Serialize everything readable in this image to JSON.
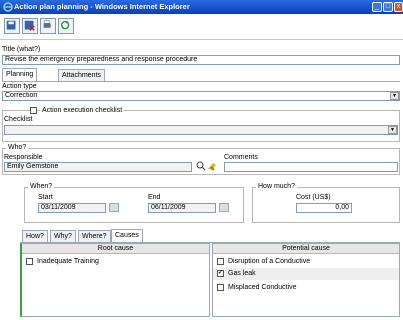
{
  "window": {
    "title": "Action plan planning - Windows Internet Explorer"
  },
  "title_section": {
    "label": "Title (what?)",
    "value": "Revise the emergency preparedness and response procedure"
  },
  "main_tabs": [
    {
      "label": "Planning"
    },
    {
      "label": "Attachments"
    }
  ],
  "action_type": {
    "label": "Action type",
    "value": "Correction"
  },
  "execution_checklist": {
    "checkbox_label": "Action execution checklist",
    "checklist_label": "Checklist",
    "value": ""
  },
  "who": {
    "group_label": "Who?",
    "responsible_label": "Responsible",
    "responsible_value": "Emily Gemstone",
    "comments_label": "Comments",
    "comments_value": ""
  },
  "when": {
    "group_label": "When?",
    "start_label": "Start",
    "start_value": "03/11/2009",
    "end_label": "End",
    "end_value": "06/11/2009"
  },
  "how_much": {
    "group_label": "How much?",
    "cost_label": "Cost (US$)",
    "cost_value": "0,00"
  },
  "sub_tabs": [
    {
      "label": "How?"
    },
    {
      "label": "Why?"
    },
    {
      "label": "Where?"
    },
    {
      "label": "Causes"
    }
  ],
  "root_cause": {
    "header": "Root cause",
    "items": [
      {
        "label": "Inadequate Training",
        "checked": false
      }
    ]
  },
  "potential_cause": {
    "header": "Potential cause",
    "items": [
      {
        "label": "Disruption of a Conductive",
        "checked": false
      },
      {
        "label": "Gas leak",
        "checked": true
      },
      {
        "label": "Misplaced Conductive",
        "checked": false
      }
    ]
  },
  "colors": {
    "titlebar": "#0a3fb8",
    "accent": "#3aa040"
  }
}
